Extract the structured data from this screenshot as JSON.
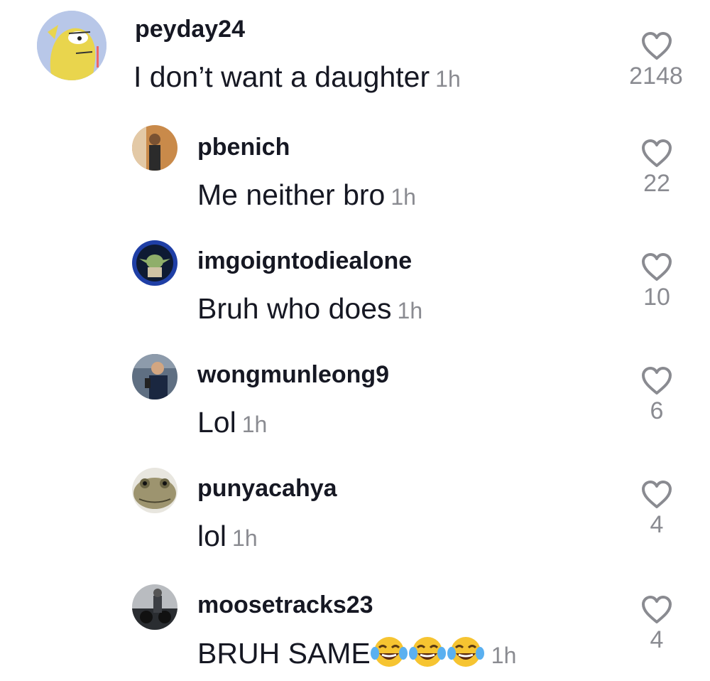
{
  "comments": [
    {
      "username": "peyday24",
      "text": "I don’t want a daughter",
      "time": "1h",
      "likes": "2148",
      "avatar": "fish-avatar"
    },
    {
      "username": "pbenich",
      "text": "Me neither bro",
      "time": "1h",
      "likes": "22",
      "avatar": "person-photo-avatar"
    },
    {
      "username": "imgoigntodiealone",
      "text": "Bruh who does",
      "time": "1h",
      "likes": "10",
      "avatar": "yoda-avatar"
    },
    {
      "username": "wongmunleong9",
      "text": "Lol",
      "time": "1h",
      "likes": "6",
      "avatar": "selfie-avatar"
    },
    {
      "username": "punyacahya",
      "text": "lol",
      "time": "1h",
      "likes": "4",
      "avatar": "frog-avatar"
    },
    {
      "username": "moosetracks23",
      "text": "BRUH SAME",
      "time": "1h",
      "likes": "4",
      "avatar": "motorbike-avatar",
      "emojis": [
        "tears-of-joy-emoji",
        "tears-of-joy-emoji",
        "tears-of-joy-emoji"
      ]
    }
  ],
  "colors": {
    "text": "#161823",
    "muted": "#8a8b91",
    "heart": "#8a8b91"
  }
}
